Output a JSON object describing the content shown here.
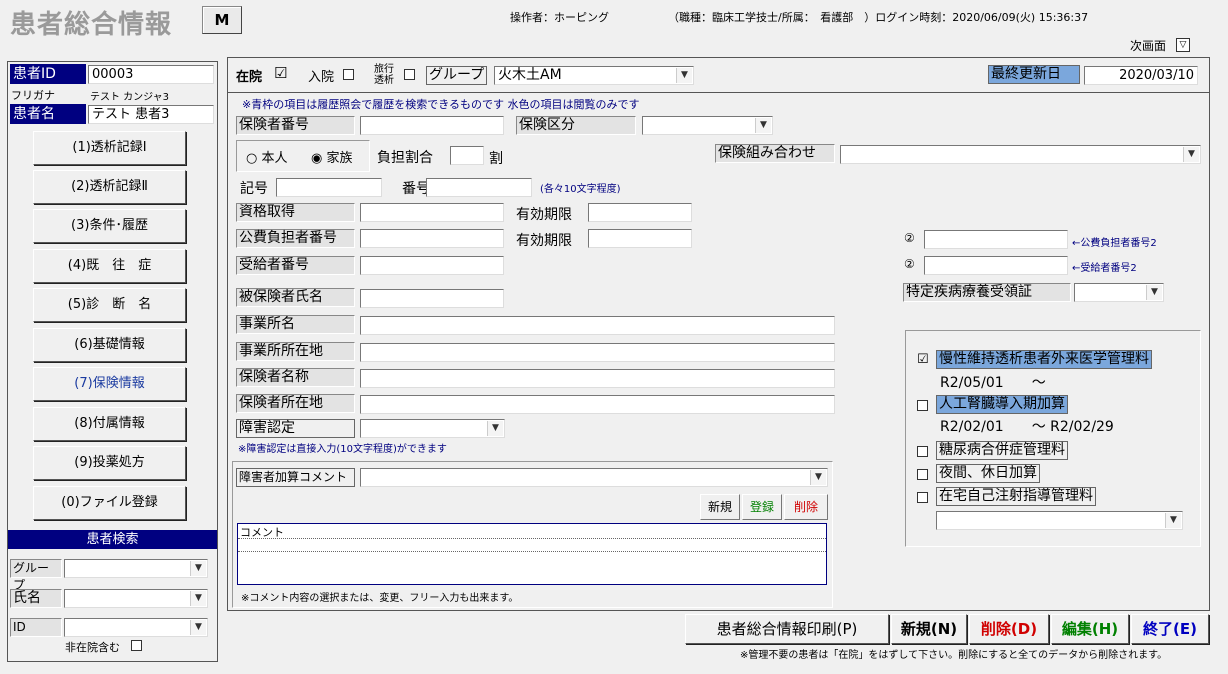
{
  "header": {
    "title": "患者総合情報",
    "m_button": "M",
    "operator_label": "操作者：",
    "operator": "ホーピング",
    "role_label": "（職種：",
    "role": "臨床工学技士",
    "dept_label": "/所属：",
    "dept": "看護部",
    "login_label": "）ログイン時刻：",
    "login_time": "2020/06/09(火) 15:36:37",
    "next_screen": "次画面"
  },
  "patient": {
    "id_label": "患者ID",
    "id": "00003",
    "furigana_label": "フリガナ",
    "furigana": "テスト カンジャ3",
    "name_label": "患者名",
    "name": "テスト 患者3"
  },
  "nav": [
    "(1)透析記録Ⅰ",
    "(2)透析記録Ⅱ",
    "(3)条件･履歴",
    "(4)既　往　症",
    "(5)診　断　名",
    "(6)基礎情報",
    "(7)保険情報",
    "(8)付属情報",
    "(9)投薬処方",
    "(0)ファイル登録"
  ],
  "search": {
    "title": "患者検索",
    "group": "グループ",
    "name": "氏名",
    "id": "ID",
    "include": "非在院含む"
  },
  "status": {
    "zaiin": "在院",
    "zaiin_mark": "☑",
    "nyuin": "入院",
    "ryoko": "旅行透析",
    "group": "グループ",
    "group_value": "火木土AM",
    "last_update_label": "最終更新日",
    "last_update": "2020/03/10"
  },
  "notes": {
    "top": "※青枠の項目は履歴照会で履歴を検索できるものです 水色の項目は閲覧のみです",
    "shogai": "※障害認定は直接入力(10文字程度)ができます",
    "comment": "※コメント内容の選択または、変更、フリー入力も出来ます。",
    "bottom": "※管理不要の患者は「在院」をはずして下さい。削除にすると全てのデータから削除されます。",
    "kigo_hint": "(各々10文字程度)"
  },
  "form": {
    "hokensha_bango": "保険者番号",
    "hoken_kubun": "保険区分",
    "honnin": "本人",
    "kazoku": "家族",
    "futan": "負担割合",
    "wari": "割",
    "kumiawase": "保険組み合わせ",
    "kigo": "記号",
    "bango": "番号",
    "shikaku": "資格取得",
    "yuko1": "有効期限",
    "kohi": "公費負担者番号",
    "yuko2": "有効期限",
    "jukyu": "受給者番号",
    "hihoken": "被保険者氏名",
    "jigyosho": "事業所名",
    "jigyosho_addr": "事業所所在地",
    "hokensha_name": "保険者名称",
    "hokensha_addr": "保険者所在地",
    "shogai": "障害認定",
    "circ2a": "②",
    "circ2b": "②",
    "kohi2": "←公費負担者番号2",
    "jukyu2": "←受給者番号2",
    "tokutei": "特定疾病療養受領証"
  },
  "comment": {
    "label": "障害者加算コメント",
    "new": "新規",
    "save": "登録",
    "delete": "削除",
    "header": "コメント"
  },
  "mgmt": [
    {
      "label": "慢性維持透析患者外来医学管理料",
      "checked": "☑",
      "date": "R2/05/01　　～"
    },
    {
      "label": "人工腎臓導入期加算",
      "checked": "",
      "date": "R2/02/01　　～ R2/02/29"
    },
    {
      "label": "糖尿病合併症管理料",
      "checked": ""
    },
    {
      "label": "夜間、休日加算",
      "checked": ""
    },
    {
      "label": "在宅自己注射指導管理料",
      "checked": ""
    }
  ],
  "buttons": {
    "print": "患者総合情報印刷(P)",
    "new": "新規(N)",
    "delete": "削除(D)",
    "edit": "編集(H)",
    "exit": "終了(E)"
  },
  "colors": {
    "navy": "#000080",
    "highlight": "#7ba7dc",
    "delete": "#d00000",
    "edit": "#008000",
    "exit": "#0000c0"
  }
}
